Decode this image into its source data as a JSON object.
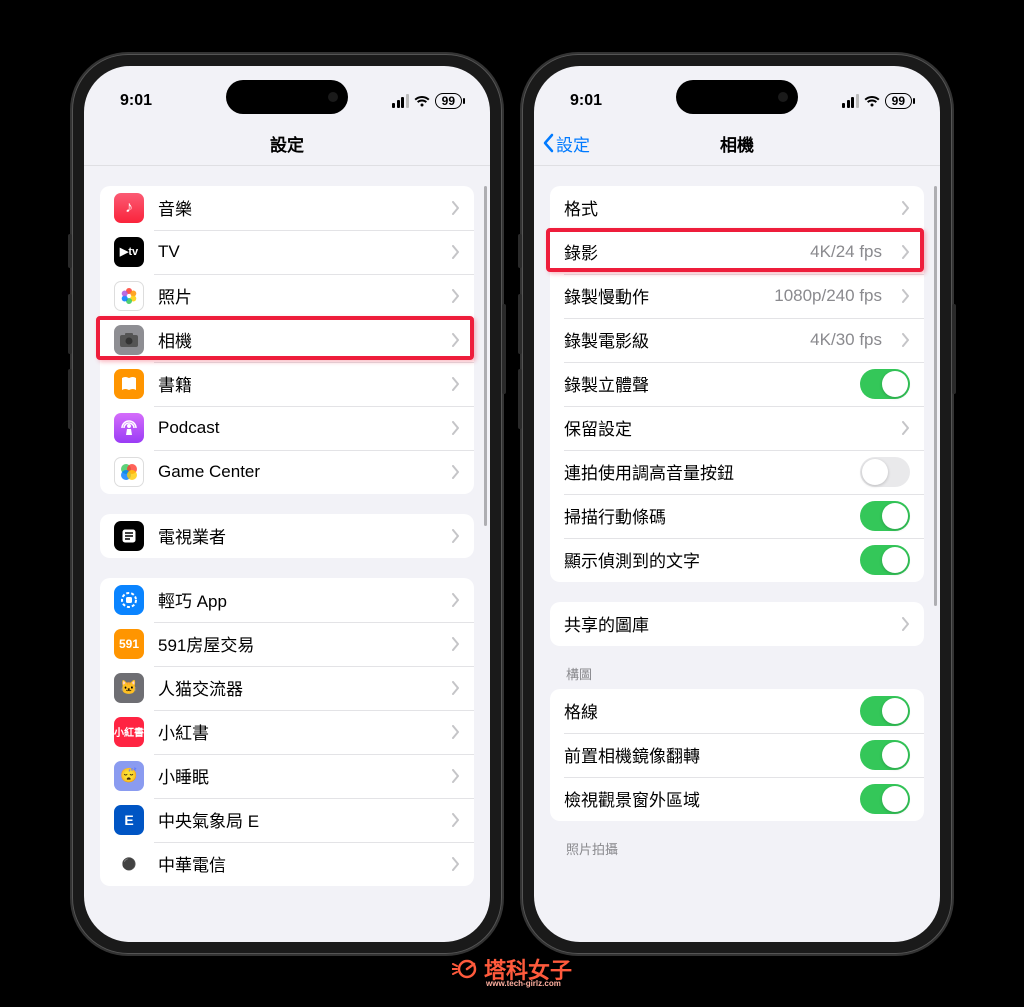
{
  "status": {
    "time": "9:01",
    "battery": "99"
  },
  "left": {
    "title": "設定",
    "group1": [
      {
        "icon": "music-icon",
        "label": "音樂"
      },
      {
        "icon": "tv-icon",
        "label": "TV"
      },
      {
        "icon": "photos-icon",
        "label": "照片"
      },
      {
        "icon": "camera-icon",
        "label": "相機"
      },
      {
        "icon": "books-icon",
        "label": "書籍"
      },
      {
        "icon": "podcast-icon",
        "label": "Podcast"
      },
      {
        "icon": "gamecenter-icon",
        "label": "Game Center"
      }
    ],
    "group2": [
      {
        "icon": "tvprovider-icon",
        "label": "電視業者"
      }
    ],
    "group3": [
      {
        "icon": "appclips-icon",
        "label": "輕巧 App"
      },
      {
        "icon": "app591-icon",
        "label": "591房屋交易"
      },
      {
        "icon": "catapp-icon",
        "label": "人猫交流器"
      },
      {
        "icon": "xhs-icon",
        "label": "小紅書"
      },
      {
        "icon": "sleep-icon",
        "label": "小睡眠"
      },
      {
        "icon": "cwb-icon",
        "label": "中央氣象局 E"
      },
      {
        "icon": "cht-icon",
        "label": "中華電信"
      }
    ],
    "highlight_index": 3
  },
  "right": {
    "back": "設定",
    "title": "相機",
    "group1": [
      {
        "label": "格式",
        "type": "link"
      },
      {
        "label": "錄影",
        "value": "4K/24 fps",
        "type": "link"
      },
      {
        "label": "錄製慢動作",
        "value": "1080p/240 fps",
        "type": "link"
      },
      {
        "label": "錄製電影級",
        "value": "4K/30 fps",
        "type": "link"
      },
      {
        "label": "錄製立體聲",
        "type": "toggle",
        "on": true
      },
      {
        "label": "保留設定",
        "type": "link"
      },
      {
        "label": "連拍使用調高音量按鈕",
        "type": "toggle",
        "on": false
      },
      {
        "label": "掃描行動條碼",
        "type": "toggle",
        "on": true
      },
      {
        "label": "顯示偵測到的文字",
        "type": "toggle",
        "on": true
      }
    ],
    "group2": [
      {
        "label": "共享的圖庫",
        "type": "link"
      }
    ],
    "section_header": "構圖",
    "group3": [
      {
        "label": "格線",
        "type": "toggle",
        "on": true
      },
      {
        "label": "前置相機鏡像翻轉",
        "type": "toggle",
        "on": true
      },
      {
        "label": "檢視觀景窗外區域",
        "type": "toggle",
        "on": true
      }
    ],
    "footer_header": "照片拍攝",
    "highlight_index": 1
  },
  "watermark": {
    "text": "塔科女子",
    "sub": "www.tech-girlz.com"
  }
}
